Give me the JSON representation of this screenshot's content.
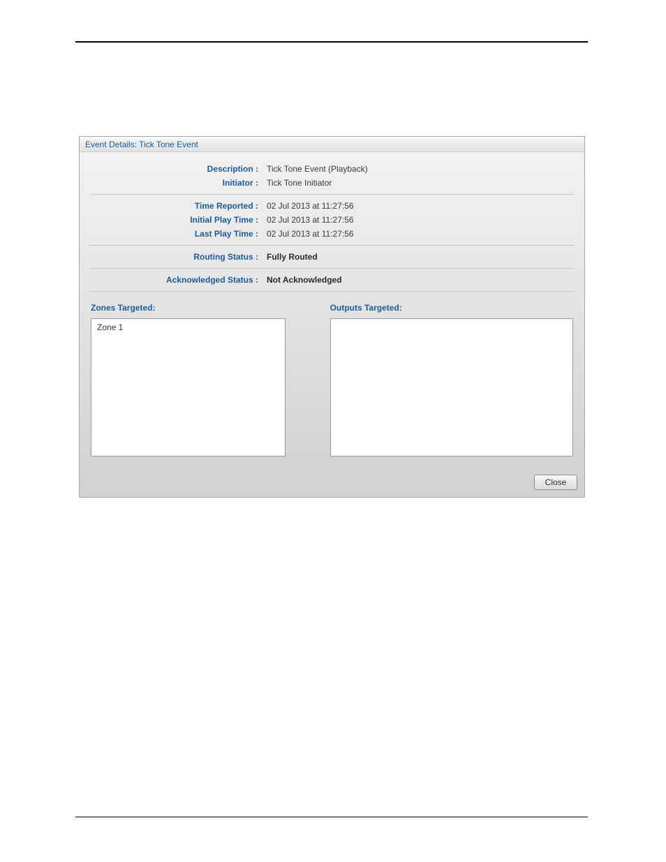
{
  "dialog": {
    "title": "Event Details: Tick Tone Event",
    "fields": {
      "description_label": "Description :",
      "description_value": "Tick Tone Event (Playback)",
      "initiator_label": "Initiator :",
      "initiator_value": "Tick Tone Initiator",
      "time_reported_label": "Time Reported :",
      "time_reported_value": "02 Jul 2013 at 11:27:56",
      "initial_play_time_label": "Initial Play Time :",
      "initial_play_time_value": "02 Jul 2013 at 11:27:56",
      "last_play_time_label": "Last Play Time :",
      "last_play_time_value": "02 Jul 2013 at 11:27:56",
      "routing_status_label": "Routing Status :",
      "routing_status_value": "Fully Routed",
      "ack_status_label": "Acknowledged Status :",
      "ack_status_value": "Not Acknowledged"
    },
    "zones_targeted": {
      "heading": "Zones Targeted:",
      "items": [
        "Zone 1"
      ]
    },
    "outputs_targeted": {
      "heading": "Outputs Targeted:",
      "items": []
    },
    "close_label": "Close"
  }
}
